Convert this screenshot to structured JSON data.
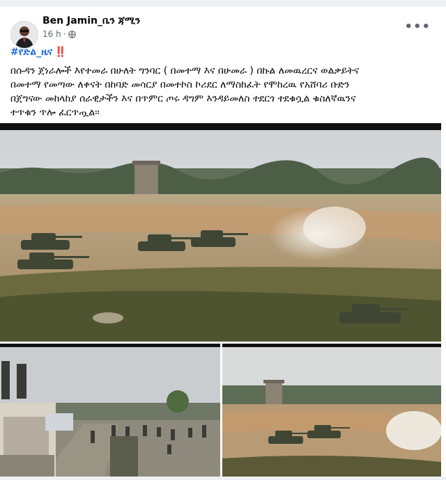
{
  "post": {
    "author": "Ben Jamin_ቤን ጃሚን",
    "time": "16 h",
    "visibility_icon": "globe-icon",
    "more_icon": "more-options-icon",
    "hashtag": "#የድል_ዜና",
    "hashtag_badge": "‼️",
    "text_lines": [
      "በሱዳን ጀነራሎች እየተመራ በሁለት ግንባር ( በመተማ እና በሁመራ ) በኩል ለመዉረርና ወልቃይትና",
      "በመተማ የመጣው ለቀናት በከባድ መሳርያ በመተኮስ ኮሪደር ለማስከፈት የሞከረዉ የአሸባሪ ቡድን",
      "በጀግናው መከላከያ ሰራዊታችን እና  በጥምር ጦሩ ዳግም እንዳይመለስ ተደርጎ ተደቁሷል ቁስለኛዉንና",
      "ተጥቁን ጥሎ ፈርጥጧል፡፡"
    ]
  },
  "photos": {
    "main": "tanks-firing-field-photo",
    "bottom_left": "troops-and-vehicles-photo",
    "bottom_right": "tanks-field-closeup-photo"
  },
  "colors": {
    "hashtag": "#216fdb",
    "meta": "#65676b",
    "text": "#050505"
  }
}
